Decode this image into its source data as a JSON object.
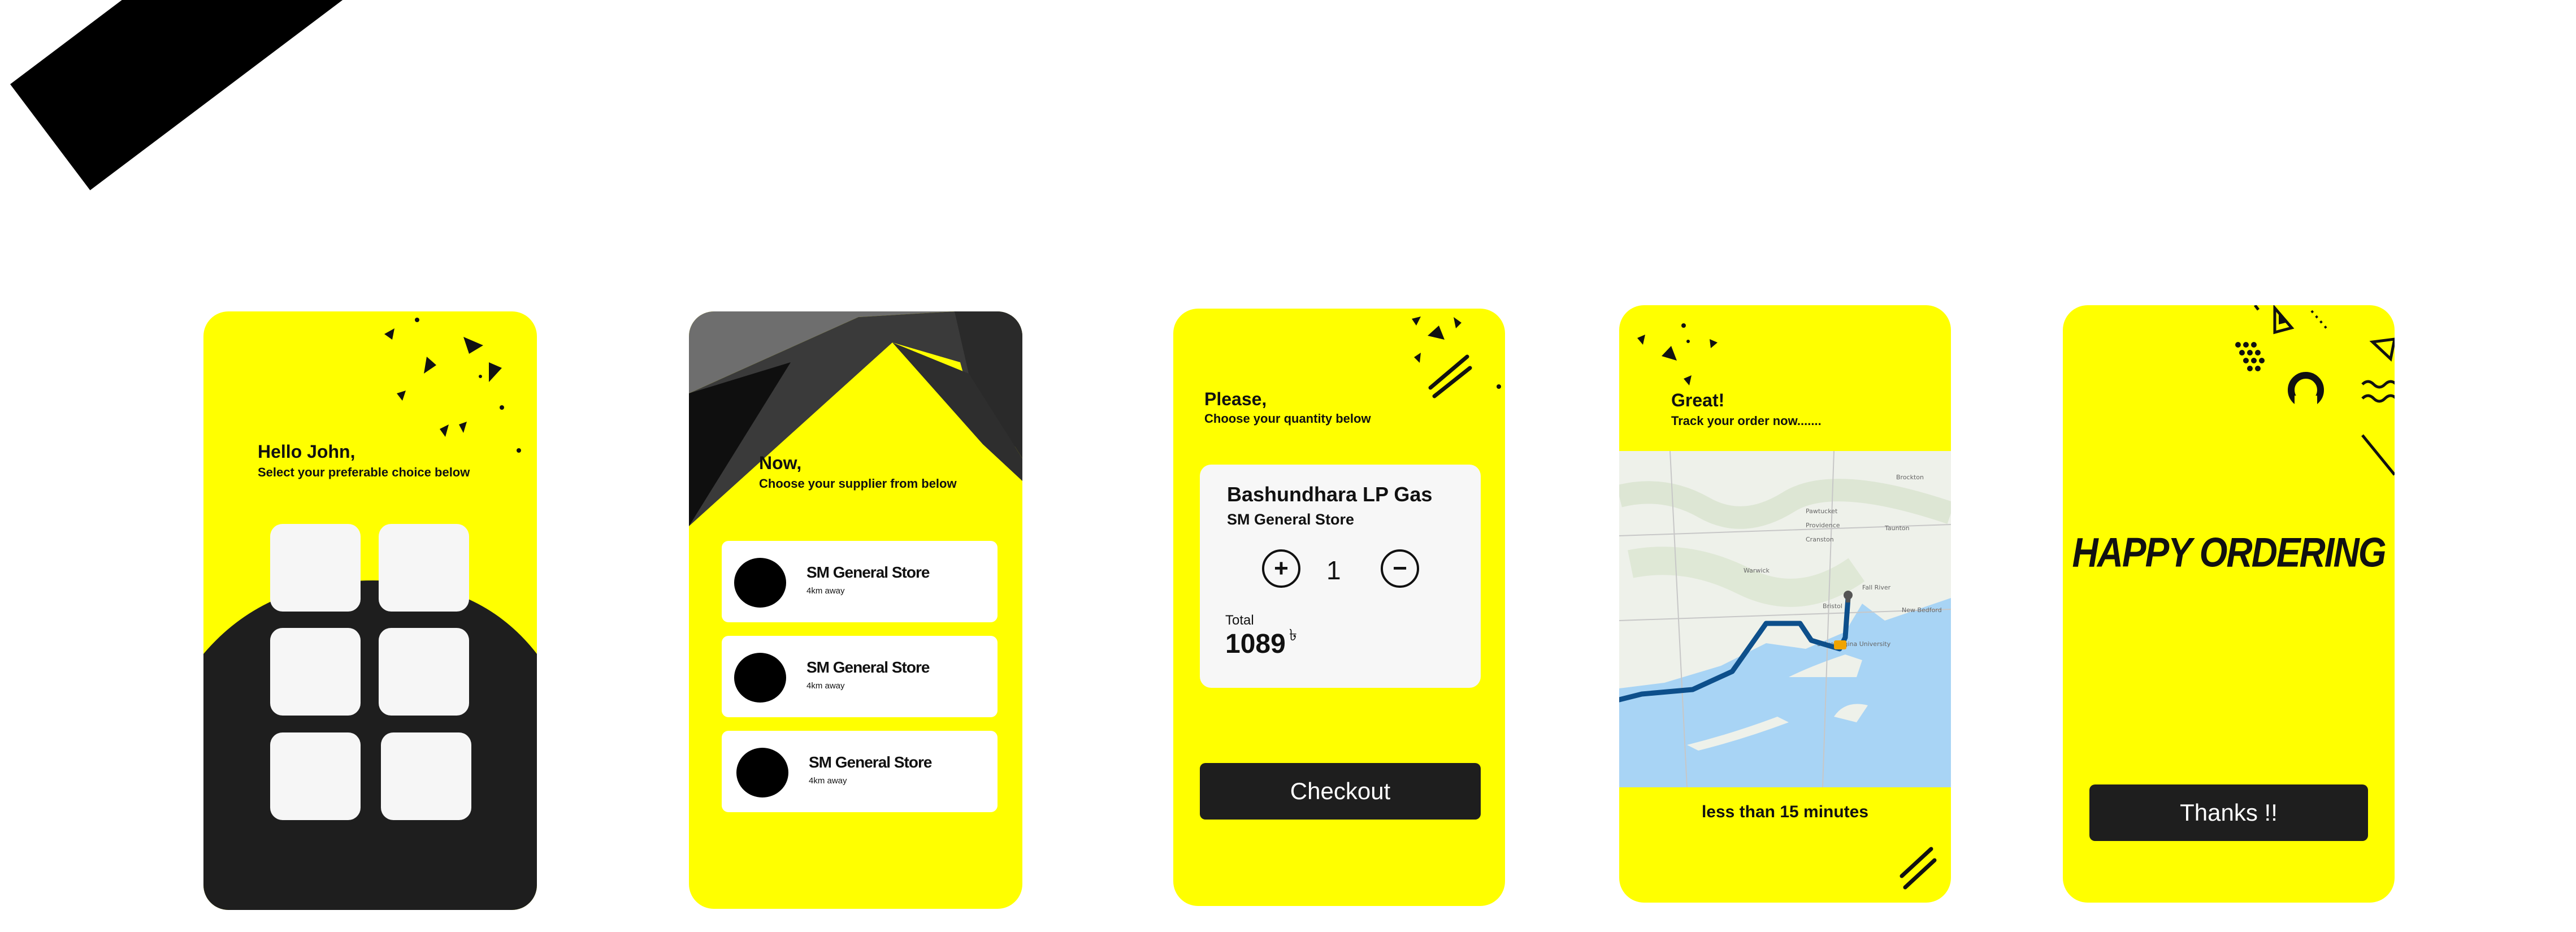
{
  "screen1": {
    "greeting": "Hello John,",
    "subtitle": "Select your preferable choice below",
    "tiles": [
      "",
      "",
      "",
      "",
      "",
      ""
    ]
  },
  "screen2": {
    "greeting": "Now,",
    "subtitle": "Choose your supplier from below",
    "suppliers": [
      {
        "name": "SM General Store",
        "distance": "4km away"
      },
      {
        "name": "SM General Store",
        "distance": "4km away"
      },
      {
        "name": "SM General Store",
        "distance": "4km away"
      }
    ]
  },
  "screen3": {
    "greeting": "Please,",
    "subtitle": "Choose your quantity below",
    "product": "Bashundhara LP Gas",
    "store": "SM General Store",
    "increment_symbol": "+",
    "decrement_symbol": "−",
    "quantity": "1",
    "total_label": "Total",
    "total_value": "1089",
    "currency_symbol": "৳",
    "checkout_label": "Checkout"
  },
  "screen4": {
    "greeting": "Great!",
    "subtitle": "Track your order now.......",
    "eta": "less than 15 minutes",
    "map_labels": [
      "Providence",
      "Cranston",
      "Warwick",
      "Fall River",
      "New Bedford",
      "Taunton",
      "Brockton",
      "Pawtucket",
      "Bristol",
      "Salve Regina University"
    ]
  },
  "screen5": {
    "title": "HAPPY ORDERING",
    "thanks_label": "Thanks !!"
  },
  "colors": {
    "accent": "#ffff00",
    "dark": "#1e1e1e",
    "card": "#f7f7f7",
    "map_water": "#a8d4f5",
    "route": "#0d4f8b"
  }
}
